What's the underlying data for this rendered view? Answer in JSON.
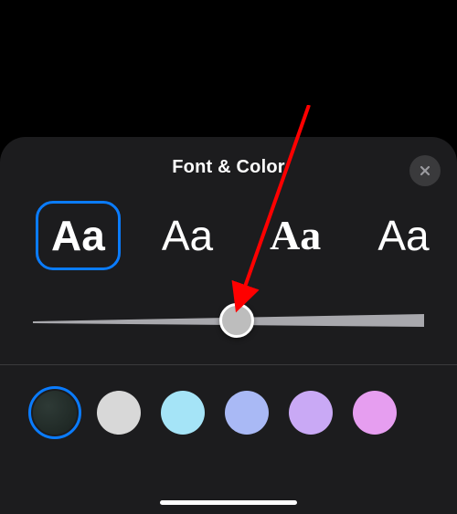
{
  "panel": {
    "title": "Font & Color",
    "close_label": "Close"
  },
  "fonts": {
    "options": [
      {
        "label": "Aa",
        "style": "sans",
        "selected": true
      },
      {
        "label": "Aa",
        "style": "sans",
        "selected": false
      },
      {
        "label": "Aa",
        "style": "serif",
        "selected": false
      },
      {
        "label": "Aa",
        "style": "sans",
        "selected": false
      }
    ]
  },
  "slider": {
    "min": 0,
    "max": 100,
    "value": 52
  },
  "colors": {
    "options": [
      {
        "name": "dark",
        "hex": "#1f2a26",
        "selected": true
      },
      {
        "name": "grey",
        "hex": "#d8d8d8",
        "selected": false
      },
      {
        "name": "lightblue",
        "hex": "#a5e4f7",
        "selected": false
      },
      {
        "name": "periwinkle",
        "hex": "#a9b9f5",
        "selected": false
      },
      {
        "name": "lavender",
        "hex": "#c9a9f5",
        "selected": false
      },
      {
        "name": "pink",
        "hex": "#e69ef0",
        "selected": false
      }
    ]
  },
  "annotation": {
    "target": "slider-thumb",
    "color": "#ff0000"
  }
}
